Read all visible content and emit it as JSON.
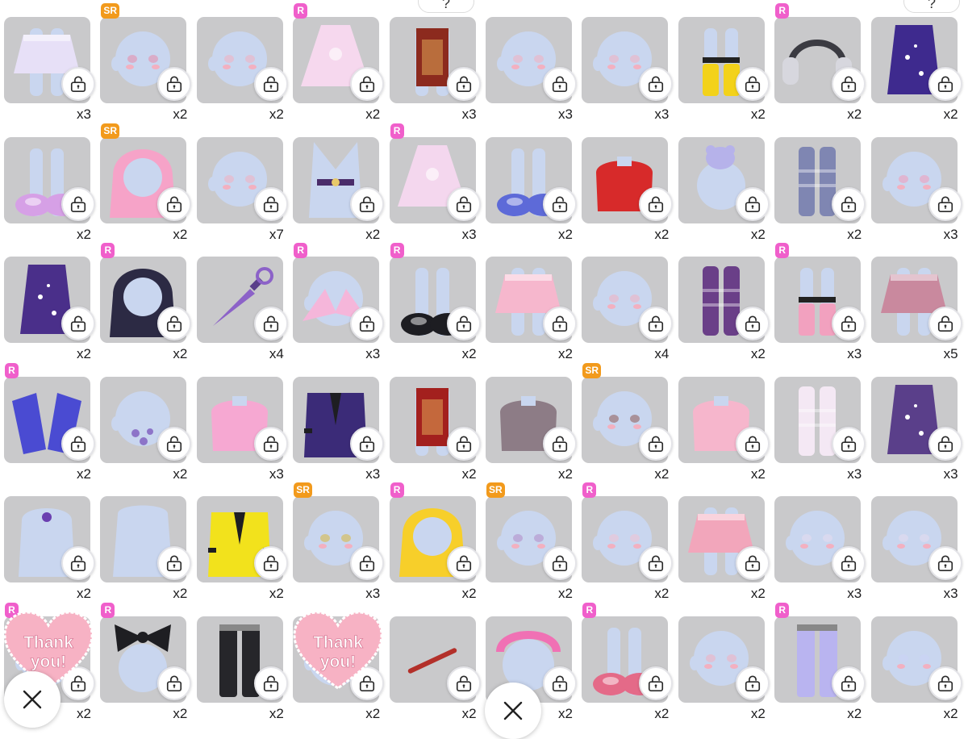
{
  "help_buttons": [
    "?",
    "?"
  ],
  "stickers": [
    {
      "text_line1": "Thank",
      "text_line2": "you!"
    },
    {
      "text_line1": "Thank",
      "text_line2": "you!"
    }
  ],
  "icons": {
    "lock": "lock-icon",
    "close": "close-icon"
  },
  "colors": {
    "card": "#c9c9cb",
    "rare_badge": "#f05fcb",
    "super_rare_badge": "#f29a1c",
    "sticker": "#f7b2c4"
  },
  "items": [
    {
      "qty": "x3",
      "badge": "",
      "kind": "skirt",
      "color": "#e7e0f7"
    },
    {
      "qty": "x2",
      "badge": "SR",
      "kind": "face",
      "color": "#e88aa8"
    },
    {
      "qty": "x2",
      "badge": "",
      "kind": "face",
      "color": "#f3b0c0"
    },
    {
      "qty": "x2",
      "badge": "R",
      "kind": "dress",
      "color": "#f6d8ee"
    },
    {
      "qty": "x3",
      "badge": "",
      "kind": "apron",
      "color": "#8c2a1e"
    },
    {
      "qty": "x3",
      "badge": "",
      "kind": "face",
      "color": "#f3b0c0"
    },
    {
      "qty": "x3",
      "badge": "",
      "kind": "face",
      "color": "#f3b0c0"
    },
    {
      "qty": "x2",
      "badge": "",
      "kind": "boots",
      "color": "#f3d21a"
    },
    {
      "qty": "x2",
      "badge": "R",
      "kind": "headphones",
      "color": "#3b3b42"
    },
    {
      "qty": "x2",
      "badge": "",
      "kind": "outfit",
      "color": "#3e2a8e"
    },
    {
      "qty": "x2",
      "badge": "",
      "kind": "shoes",
      "color": "#d6a0e6"
    },
    {
      "qty": "x2",
      "badge": "SR",
      "kind": "hair",
      "color": "#f6a3c8"
    },
    {
      "qty": "x7",
      "badge": "",
      "kind": "face",
      "color": "#f3b0c0"
    },
    {
      "qty": "x2",
      "badge": "",
      "kind": "belt",
      "color": "#4a2c6a"
    },
    {
      "qty": "x3",
      "badge": "R",
      "kind": "dress",
      "color": "#f4d7ee"
    },
    {
      "qty": "x2",
      "badge": "",
      "kind": "shoes",
      "color": "#5d6ad8"
    },
    {
      "qty": "x2",
      "badge": "",
      "kind": "top",
      "color": "#d72a2a"
    },
    {
      "qty": "x2",
      "badge": "",
      "kind": "plush",
      "color": "#b6b2ea"
    },
    {
      "qty": "x2",
      "badge": "",
      "kind": "socks",
      "color": "#7f86b2"
    },
    {
      "qty": "x3",
      "badge": "",
      "kind": "face",
      "color": "#f29ab8"
    },
    {
      "qty": "x2",
      "badge": "",
      "kind": "outfit",
      "color": "#4a2f8a"
    },
    {
      "qty": "x2",
      "badge": "R",
      "kind": "hair",
      "color": "#2c2a44"
    },
    {
      "qty": "x4",
      "badge": "",
      "kind": "kunai",
      "color": "#8c62c8"
    },
    {
      "qty": "x3",
      "badge": "R",
      "kind": "accessory",
      "color": "#f5b6da"
    },
    {
      "qty": "x2",
      "badge": "R",
      "kind": "shoes",
      "color": "#1d1d22"
    },
    {
      "qty": "x2",
      "badge": "",
      "kind": "skirt",
      "color": "#f6b7cd"
    },
    {
      "qty": "x4",
      "badge": "",
      "kind": "face",
      "color": "#f3b0c0"
    },
    {
      "qty": "x2",
      "badge": "",
      "kind": "socks",
      "color": "#6a3f88"
    },
    {
      "qty": "x3",
      "badge": "R",
      "kind": "boots",
      "color": "#f2a1bf"
    },
    {
      "qty": "x5",
      "badge": "",
      "kind": "skirt",
      "color": "#c9899e"
    },
    {
      "qty": "x2",
      "badge": "R",
      "kind": "sleeves",
      "color": "#4a4bd2"
    },
    {
      "qty": "x2",
      "badge": "",
      "kind": "tattoo",
      "color": "#8d74c8"
    },
    {
      "qty": "x3",
      "badge": "",
      "kind": "top",
      "color": "#f6a8d2"
    },
    {
      "qty": "x3",
      "badge": "",
      "kind": "jacket",
      "color": "#3b2b78"
    },
    {
      "qty": "x2",
      "badge": "",
      "kind": "apron",
      "color": "#a3201e"
    },
    {
      "qty": "x2",
      "badge": "",
      "kind": "top",
      "color": "#8d7c86"
    },
    {
      "qty": "x2",
      "badge": "SR",
      "kind": "face",
      "color": "#8e5a52"
    },
    {
      "qty": "x2",
      "badge": "",
      "kind": "top",
      "color": "#f6b6cc"
    },
    {
      "qty": "x3",
      "badge": "",
      "kind": "socks",
      "color": "#f4e8f4"
    },
    {
      "qty": "x3",
      "badge": "",
      "kind": "outfit",
      "color": "#5a3f8a"
    },
    {
      "qty": "x2",
      "badge": "",
      "kind": "necklace",
      "color": "#6b3fb0"
    },
    {
      "qty": "x2",
      "badge": "",
      "kind": "body",
      "color": "#c9d6ef"
    },
    {
      "qty": "x2",
      "badge": "",
      "kind": "jacket",
      "color": "#f2e21c"
    },
    {
      "qty": "x3",
      "badge": "SR",
      "kind": "face",
      "color": "#d8b83a"
    },
    {
      "qty": "x2",
      "badge": "R",
      "kind": "hair",
      "color": "#f7cf2a"
    },
    {
      "qty": "x2",
      "badge": "SR",
      "kind": "face",
      "color": "#b18ac6"
    },
    {
      "qty": "x2",
      "badge": "R",
      "kind": "face",
      "color": "#f3c3d2"
    },
    {
      "qty": "x2",
      "badge": "",
      "kind": "skirt",
      "color": "#f2a6bb"
    },
    {
      "qty": "x3",
      "badge": "",
      "kind": "face",
      "color": "#e6dcee"
    },
    {
      "qty": "x3",
      "badge": "",
      "kind": "face",
      "color": "#e6dcee"
    },
    {
      "qty": "x2",
      "badge": "R",
      "kind": "hidden",
      "color": "#f3b0c0"
    },
    {
      "qty": "x2",
      "badge": "R",
      "kind": "bow",
      "color": "#1e1e22"
    },
    {
      "qty": "x2",
      "badge": "",
      "kind": "pants",
      "color": "#26262a"
    },
    {
      "qty": "x2",
      "badge": "",
      "kind": "hidden",
      "color": "#f3b0c0"
    },
    {
      "qty": "x2",
      "badge": "",
      "kind": "stick",
      "color": "#b3302a"
    },
    {
      "qty": "x2",
      "badge": "",
      "kind": "headband",
      "color": "#f071b4"
    },
    {
      "qty": "x2",
      "badge": "R",
      "kind": "shoes",
      "color": "#e46a88"
    },
    {
      "qty": "x2",
      "badge": "",
      "kind": "face",
      "color": "#f3b0c0"
    },
    {
      "qty": "x2",
      "badge": "R",
      "kind": "pants",
      "color": "#b9b4f0"
    },
    {
      "qty": "x2",
      "badge": "",
      "kind": "face",
      "color": "#cbd4f6"
    }
  ]
}
